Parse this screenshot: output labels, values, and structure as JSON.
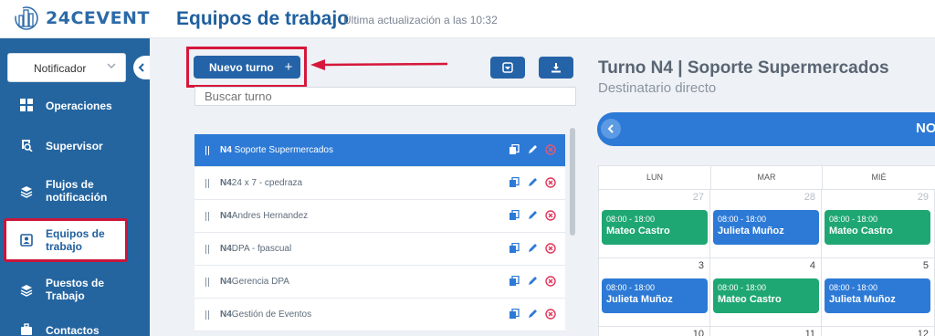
{
  "header": {
    "logo_text": "24CEVENT",
    "title": "Equipos de trabajo",
    "subtitle": "Última actualización a las 10:32"
  },
  "sidebar": {
    "select_value": "Notificador",
    "items": [
      {
        "label": "Operaciones",
        "icon": "grid-icon"
      },
      {
        "label": "Supervisor",
        "icon": "supervisor-icon"
      },
      {
        "label": "Flujos de notificación",
        "icon": "layers-icon"
      },
      {
        "label": "Equipos de trabajo",
        "icon": "team-card-icon",
        "active": true
      },
      {
        "label": "Puestos de Trabajo",
        "icon": "layers-icon"
      },
      {
        "label": "Contactos",
        "icon": "briefcase-icon"
      }
    ]
  },
  "toolbar": {
    "new_turn_label": "Nuevo turno",
    "search_placeholder": "Buscar turno"
  },
  "turns": [
    {
      "code": "N4",
      "name": "Soporte Supermercados",
      "selected": true
    },
    {
      "code": "N4",
      "name": "24 x 7 - cpedraza"
    },
    {
      "code": "N4",
      "name": "Andres Hernandez"
    },
    {
      "code": "N4",
      "name": "DPA - fpascual"
    },
    {
      "code": "N4",
      "name": "Gerencia DPA"
    },
    {
      "code": "N4",
      "name": "Gestión de Eventos"
    }
  ],
  "detail": {
    "title": "Turno N4 | Soporte Supermercados",
    "subtitle": "Destinatario directo"
  },
  "calendar": {
    "month_label": "NO",
    "days": [
      "LUN",
      "MAR",
      "MIÉ"
    ],
    "week1": [
      {
        "num": "27",
        "event": {
          "time": "08:00 - 18:00",
          "name": "Mateo Castro",
          "color": "green"
        }
      },
      {
        "num": "28",
        "event": {
          "time": "08:00 - 18:00",
          "name": "Julieta Muñoz",
          "color": "blue"
        }
      },
      {
        "num": "29",
        "event": {
          "time": "08:00 - 18:00",
          "name": "Mateo Castro",
          "color": "green"
        }
      }
    ],
    "week2": [
      {
        "num": "3",
        "event": {
          "time": "08:00 - 18:00",
          "name": "Julieta Muñoz",
          "color": "blue"
        }
      },
      {
        "num": "4",
        "event": {
          "time": "08:00 - 18:00",
          "name": "Mateo Castro",
          "color": "green"
        }
      },
      {
        "num": "5",
        "event": {
          "time": "08:00 - 18:00",
          "name": "Julieta Muñoz",
          "color": "blue"
        }
      }
    ],
    "week3": [
      {
        "num": "10"
      },
      {
        "num": "11"
      },
      {
        "num": "12"
      }
    ]
  },
  "colors": {
    "primary": "#2563a8",
    "selected_row": "#2d7ad6",
    "event_green": "#1fa773",
    "highlight_red": "#d6173b"
  }
}
